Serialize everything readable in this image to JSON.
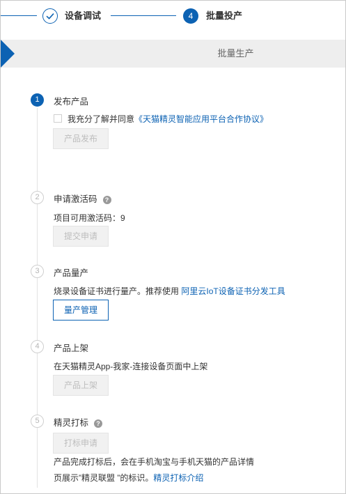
{
  "stepper": {
    "step_a_label": "设备调试",
    "step_b_number": "4",
    "step_b_label": "批量投产"
  },
  "banner": {
    "title": "批量生产"
  },
  "steps": [
    {
      "number": "1",
      "title": "发布产品",
      "agreement_prefix": "我充分了解并同意",
      "agreement_link": "《天猫精灵智能应用平台合作协议》",
      "button": "产品发布"
    },
    {
      "number": "2",
      "title": "申请激活码",
      "help": "?",
      "text": "项目可用激活码：9",
      "button": "提交申请"
    },
    {
      "number": "3",
      "title": "产品量产",
      "text_prefix": "烧录设备证书进行量产。推荐使用",
      "text_link": "阿里云IoT设备证书分发工具",
      "button": "量产管理"
    },
    {
      "number": "4",
      "title": "产品上架",
      "text": "在天猫精灵App-我家-连接设备页面中上架",
      "button": "产品上架"
    },
    {
      "number": "5",
      "title": "精灵打标",
      "help": "?",
      "button": "打标申请",
      "text_line1": "产品完成打标后，会在手机淘宝与手机天猫的产品详情",
      "text_line2": "页展示”精灵联盟 ”的标识。",
      "text_link": "精灵打标介绍"
    }
  ],
  "colors": {
    "accent": "#0c62b3",
    "disabled_bg": "#f1f1f1",
    "banner_bg": "#eeeeee"
  }
}
